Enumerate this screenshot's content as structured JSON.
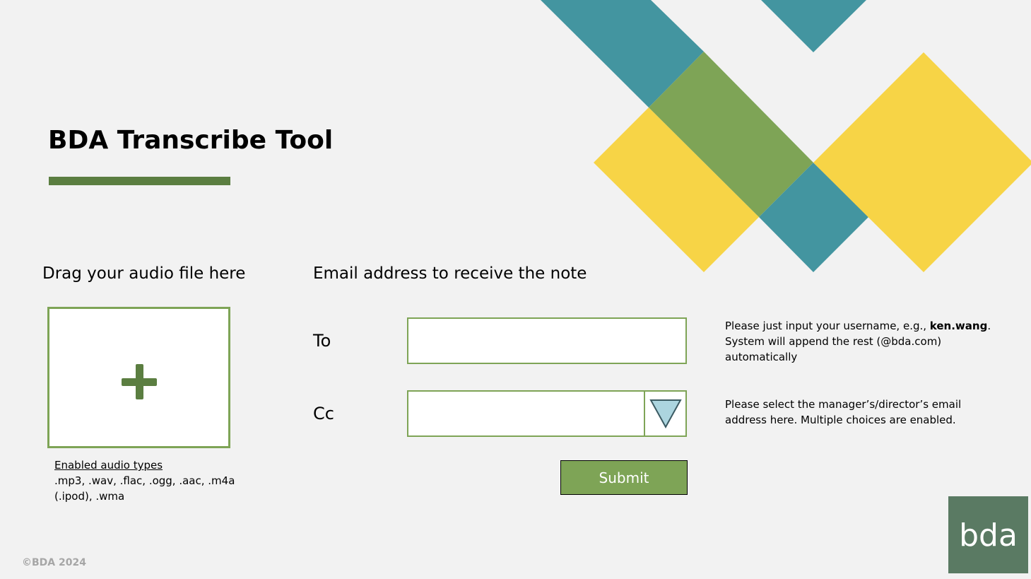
{
  "app": {
    "title": "BDA Transcribe Tool"
  },
  "upload": {
    "heading": "Drag your audio file here",
    "add_icon": "plus-icon",
    "types_label": "Enabled audio types",
    "types_value": ".mp3, .wav, .flac, .ogg, .aac, .m4a (.ipod), .wma"
  },
  "email": {
    "heading": "Email address to receive the note",
    "to_label": "To",
    "to_value": "",
    "to_help_prefix": "Please just input your username, e.g., ",
    "to_help_example": "ken.wang",
    "to_help_suffix": ". System will append the rest (@bda.com) automatically",
    "cc_label": "Cc",
    "cc_value": "",
    "cc_dropdown_icon": "triangle-down-icon",
    "cc_help": "Please select the manager’s/director’s email address here. Multiple choices are enabled.",
    "submit_label": "Submit"
  },
  "branding": {
    "logo_text": "bda",
    "copyright": "©BDA 2024"
  },
  "colors": {
    "background": "#f2f2f2",
    "green_dark": "#5b7e41",
    "green": "#7ea456",
    "teal": "#4395a0",
    "yellow": "#f7d446",
    "logo_bg": "#5a7a63",
    "dropdown_fill": "#acd5df"
  }
}
